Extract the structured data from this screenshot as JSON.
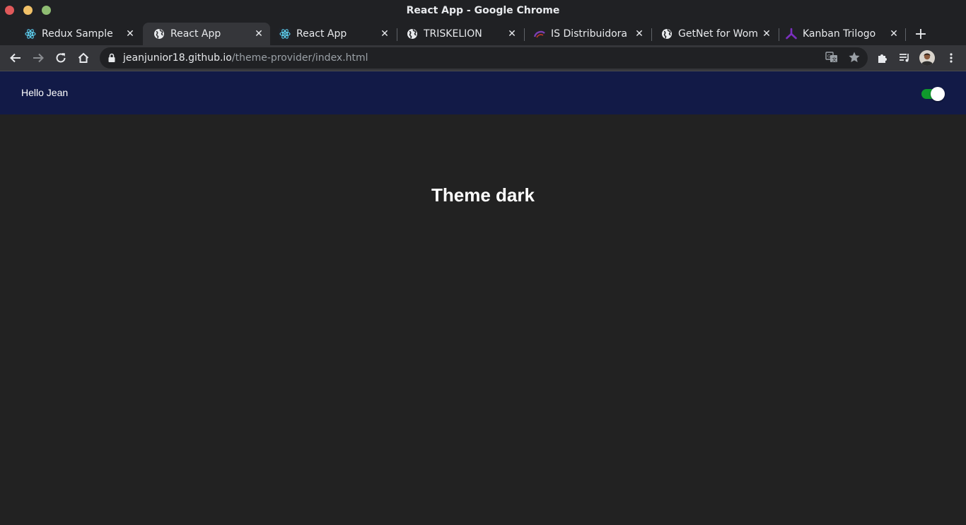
{
  "window": {
    "title": "React App - Google Chrome"
  },
  "tabs": [
    {
      "label": "Redux Sample",
      "icon": "react-icon",
      "active": false
    },
    {
      "label": "React App",
      "icon": "globe-icon",
      "active": true
    },
    {
      "label": "React App",
      "icon": "react-icon",
      "active": false
    },
    {
      "label": "TRISKELION",
      "icon": "globe-icon",
      "active": false
    },
    {
      "label": "IS Distribuidora",
      "icon": "is-logo-icon",
      "active": false
    },
    {
      "label": "GetNet for Wom",
      "icon": "globe-icon",
      "active": false
    },
    {
      "label": "Kanban Trilogo",
      "icon": "trilogo-icon",
      "active": false
    }
  ],
  "address_bar": {
    "host": "jeanjunior18.github.io",
    "path": "/theme-provider/index.html"
  },
  "app": {
    "greeting": "Hello Jean",
    "theme_toggle_on": true,
    "heading": "Theme dark"
  },
  "colors": {
    "header_bg": "#121a47",
    "page_bg": "#222222",
    "toggle_on": "#0f9a2c",
    "react_cyan": "#61dafb",
    "trilogo_purple": "#7b2fbf"
  }
}
